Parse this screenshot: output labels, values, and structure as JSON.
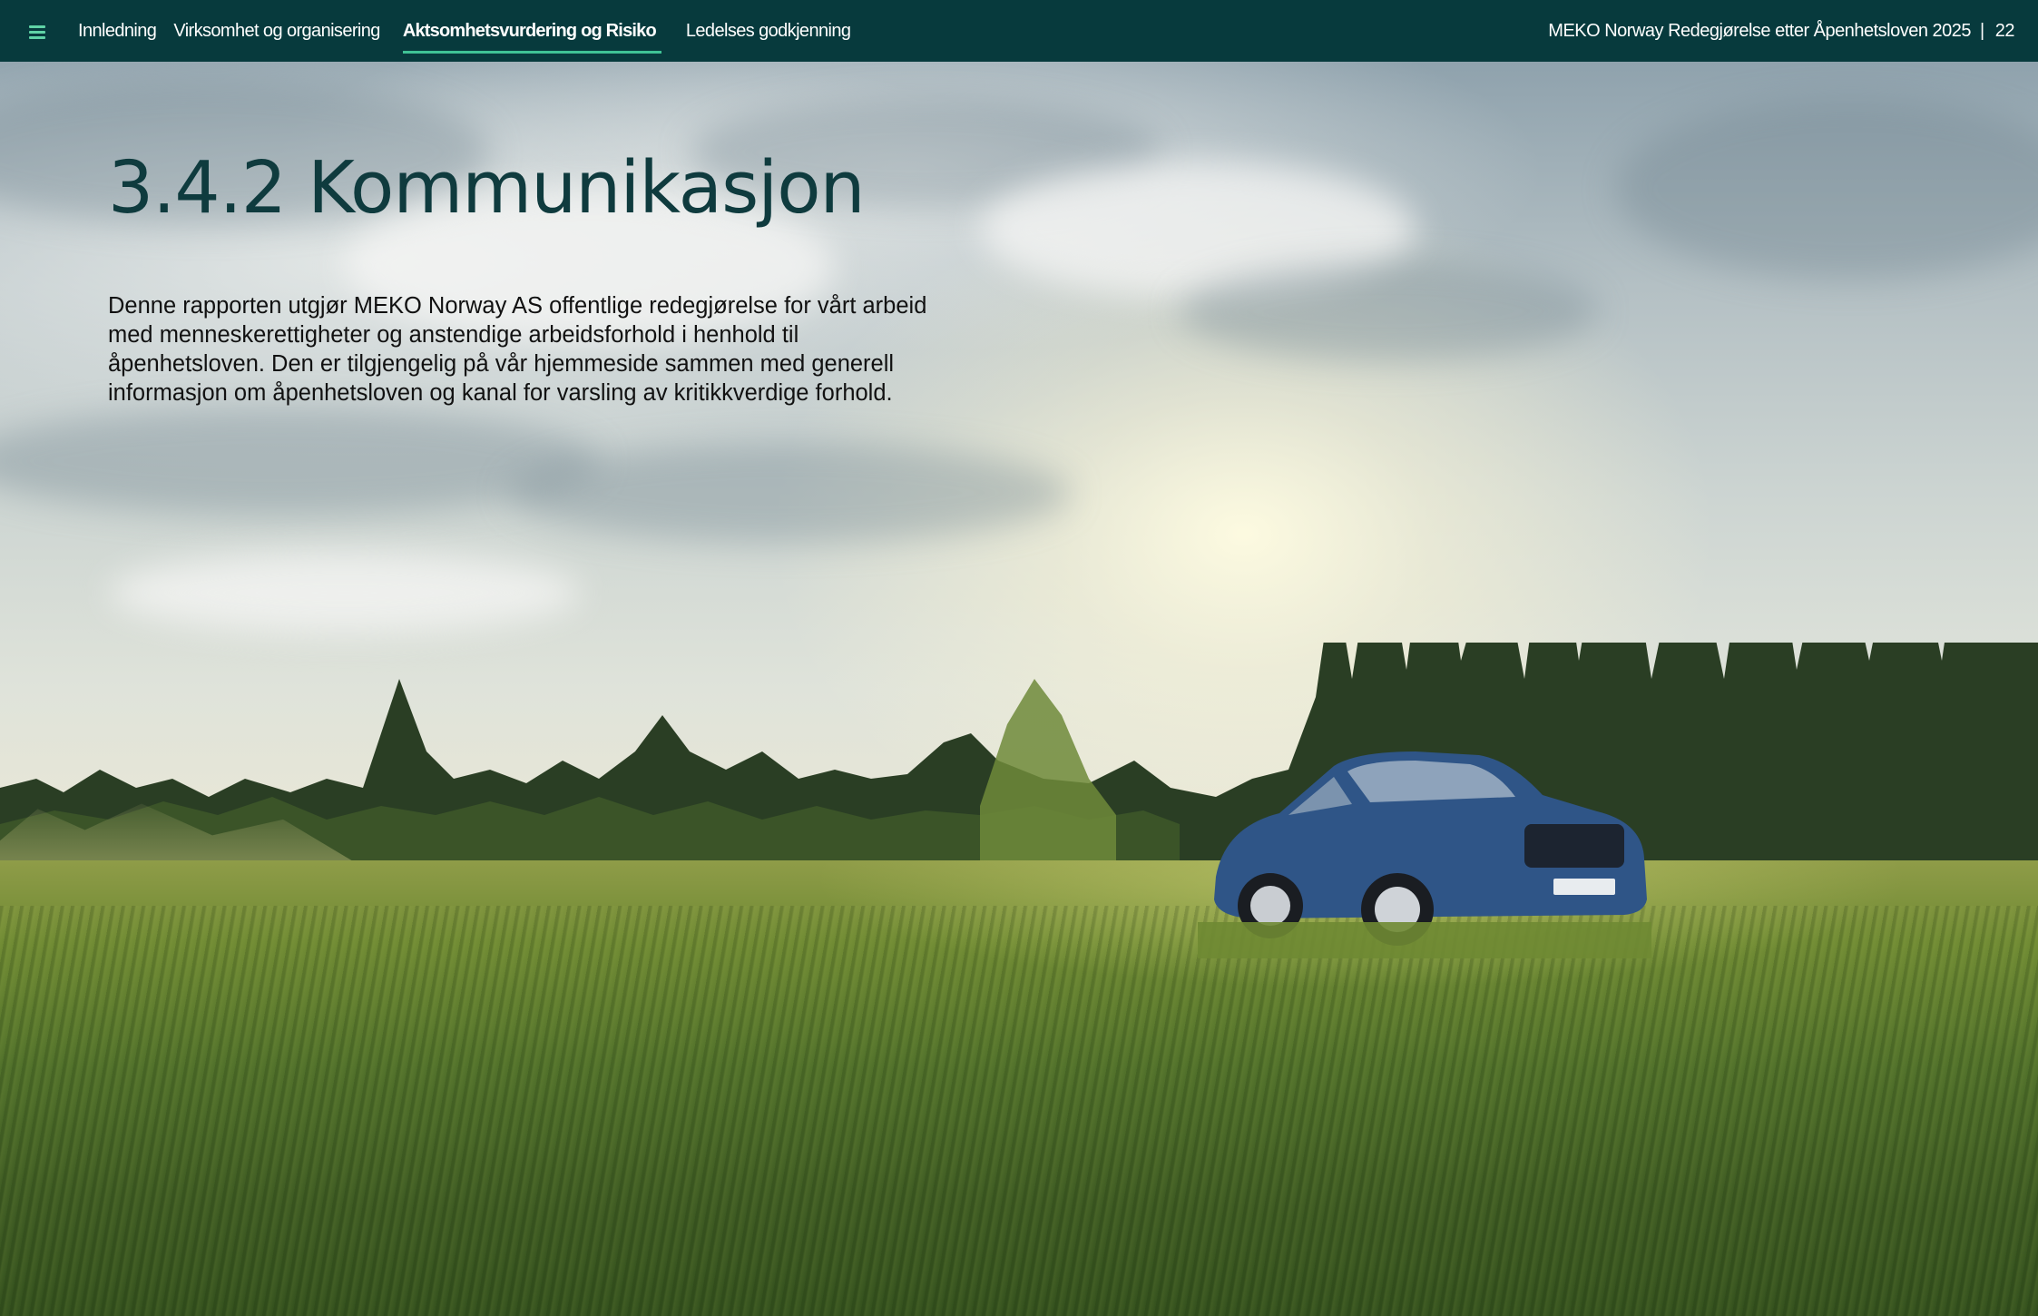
{
  "nav": {
    "menu_icon": "hamburger-menu-icon",
    "accent_color": "#3fc295",
    "background_color": "#073a3d",
    "items": [
      {
        "label": "Innledning",
        "active": false
      },
      {
        "label": "Virksomhet og organisering",
        "active": false
      },
      {
        "label": "Aktsomhetsvurdering  og Risiko",
        "active": true
      },
      {
        "label": "Ledelses godkjenning",
        "active": false
      }
    ],
    "report_title": "MEKO Norway Redegjørelse etter Åpenhetsloven 2025",
    "separator": "|",
    "page_number": "22"
  },
  "main": {
    "heading": "3.4.2 Kommunikasjon",
    "heading_color": "#0f3b3e",
    "body": "Denne rapporten utgjør MEKO Norway AS offentlige redegjørelse for vårt arbeid med menneskerettigheter og anstendige arbeidsforhold i henhold til åpenhetsloven. Den er tilgjengelig på vår hjemmeside sammen med generell informasjon om åpenhetsloven og kanal for varsling av kritikkverdige forhold."
  }
}
